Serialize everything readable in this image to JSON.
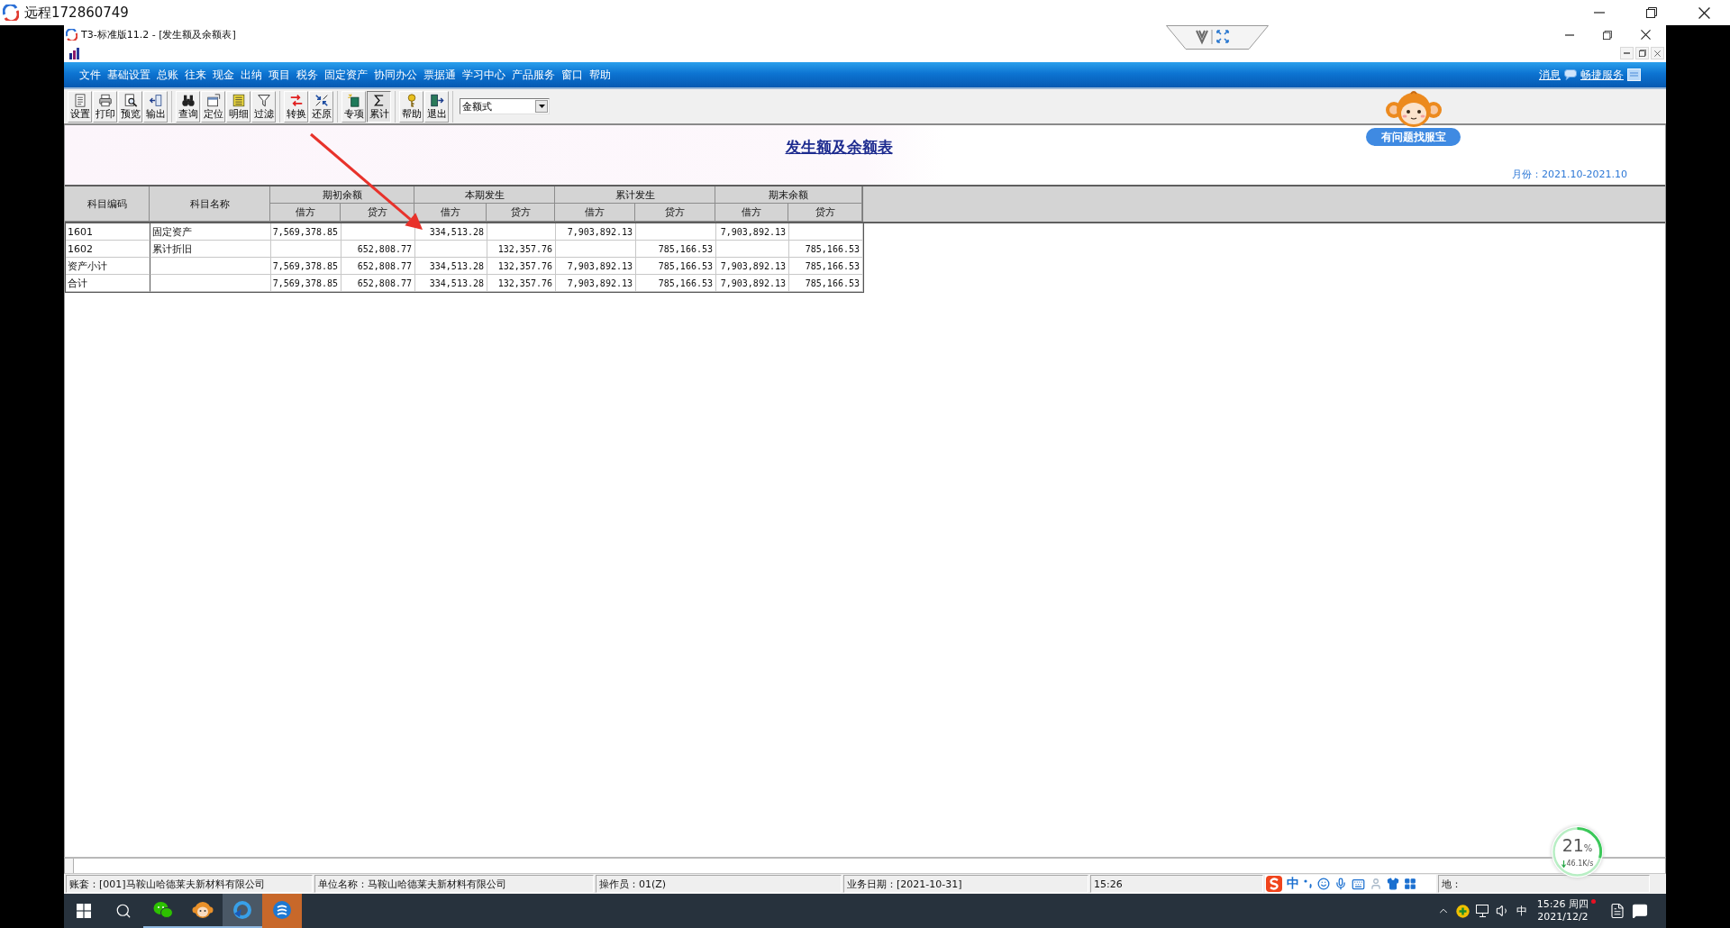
{
  "remote_window": {
    "title": "远程172860749"
  },
  "app_window": {
    "title": "T3-标准版11.2 - [发生额及余额表]"
  },
  "menu_bar": {
    "items": [
      "文件",
      "基础设置",
      "总账",
      "往来",
      "现金",
      "出纳",
      "项目",
      "税务",
      "固定资产",
      "协同办公",
      "票据通",
      "学习中心",
      "产品服务",
      "窗口",
      "帮助"
    ],
    "links": [
      "消息",
      "畅捷服务"
    ]
  },
  "toolbar": {
    "groups": [
      [
        {
          "label": "设置",
          "pressed": false
        },
        {
          "label": "打印",
          "pressed": false
        },
        {
          "label": "预览",
          "pressed": false
        },
        {
          "label": "输出",
          "pressed": false
        }
      ],
      [
        {
          "label": "查询",
          "pressed": false
        },
        {
          "label": "定位",
          "pressed": false
        },
        {
          "label": "明细",
          "pressed": false
        },
        {
          "label": "过滤",
          "pressed": false
        }
      ],
      [
        {
          "label": "转换",
          "pressed": false
        },
        {
          "label": "还原",
          "pressed": false
        }
      ],
      [
        {
          "label": "专项",
          "pressed": false
        },
        {
          "label": "累计",
          "pressed": true
        }
      ],
      [
        {
          "label": "帮助",
          "pressed": false
        },
        {
          "label": "退出",
          "pressed": false
        }
      ]
    ],
    "view_select": {
      "value": "金额式"
    }
  },
  "assistant": {
    "label": "有问题找服宝"
  },
  "report": {
    "title": "发生额及余额表",
    "period": "月份：2021.10-2021.10",
    "columns": [
      {
        "label": "科目编码"
      },
      {
        "label": "科目名称"
      },
      {
        "label": "期初余额",
        "subcolumns": [
          "借方",
          "贷方"
        ]
      },
      {
        "label": "本期发生",
        "subcolumns": [
          "借方",
          "贷方"
        ]
      },
      {
        "label": "累计发生",
        "subcolumns": [
          "借方",
          "贷方"
        ]
      },
      {
        "label": "期末余额",
        "subcolumns": [
          "借方",
          "贷方"
        ]
      }
    ],
    "rows": [
      {
        "code": "1601",
        "name": "固定资产",
        "opening_debit": "7,569,378.85",
        "period_debit": "334,513.28",
        "cumulative_debit": "7,903,892.13",
        "closing_debit": "7,903,892.13"
      },
      {
        "code": "1602",
        "name": "累计折旧",
        "opening_credit": "652,808.77",
        "period_credit": "132,357.76",
        "cumulative_credit": "785,166.53",
        "closing_credit": "785,166.53"
      },
      {
        "code": "资产小计",
        "opening_debit": "7,569,378.85",
        "opening_credit": "652,808.77",
        "period_debit": "334,513.28",
        "period_credit": "132,357.76",
        "cumulative_debit": "7,903,892.13",
        "cumulative_credit": "785,166.53",
        "closing_debit": "7,903,892.13",
        "closing_credit": "785,166.53"
      },
      {
        "code": "合计",
        "opening_debit": "7,569,378.85",
        "opening_credit": "652,808.77",
        "period_debit": "334,513.28",
        "period_credit": "132,357.76",
        "cumulative_debit": "7,903,892.13",
        "cumulative_credit": "785,166.53",
        "closing_debit": "7,903,892.13",
        "closing_credit": "785,166.53"
      }
    ]
  },
  "annotations": [
    {
      "kind": "arrow"
    }
  ],
  "status_bar": {
    "fields": [
      "账套：[001]马鞍山哈德莱夫新材料有限公司",
      "单位名称：马鞍山哈德莱夫新材料有限公司",
      "操作员：01(Z)",
      "业务日期：[2021-10-31]",
      "15:26",
      "地："
    ]
  },
  "ime_toolbar": {
    "mode": "中"
  },
  "net_monitor": {
    "percent": "21",
    "unit": "%",
    "speed": "46.1K/s"
  },
  "taskbar": {
    "apps": [
      {
        "running": true,
        "selected": false,
        "flashing": false
      },
      {
        "running": true,
        "selected": false,
        "flashing": false
      },
      {
        "running": true,
        "selected": true,
        "flashing": false
      },
      {
        "running": false,
        "selected": false,
        "flashing": true
      }
    ],
    "tray": {
      "input_mode": "中",
      "time": "15:26 周四",
      "date": "2021/12/2",
      "notification": true
    }
  }
}
